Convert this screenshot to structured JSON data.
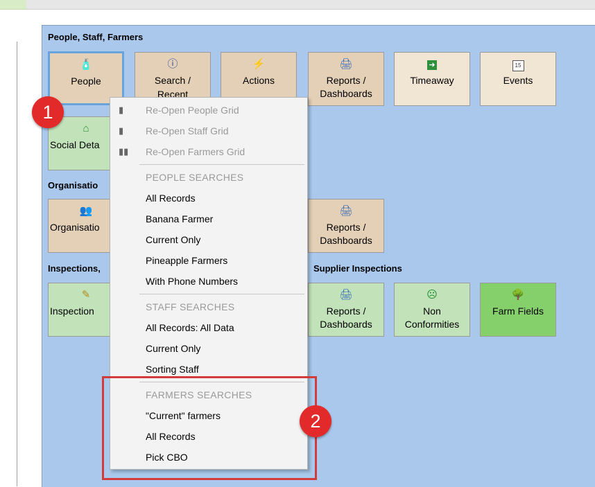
{
  "sections": {
    "people": "People, Staff, Farmers",
    "organisations": "Organisatio",
    "inspections_left": "Inspections,",
    "supplier_inspections": "Supplier Inspections"
  },
  "tiles": {
    "people": {
      "label": "People",
      "icon": "bottle-icon"
    },
    "search": {
      "label": "Search /",
      "label2": "Recent",
      "icon": "info-icon"
    },
    "actions": {
      "label": "Actions",
      "icon": "lightning-icon"
    },
    "reports1": {
      "label": "Reports /",
      "label2": "Dashboards",
      "icon": "printer-icon"
    },
    "timeaway": {
      "label": "Timeaway",
      "icon": "arrow-right-icon"
    },
    "events": {
      "label": "Events",
      "icon": "calendar-icon",
      "icon_text": "15"
    },
    "social": {
      "label": "Social Deta",
      "icon": "house-icon"
    },
    "organisations": {
      "label": "Organisatio",
      "icon": "group-icon"
    },
    "reports2": {
      "label": "Reports /",
      "label2": "Dashboards",
      "icon": "printer-icon"
    },
    "inspections": {
      "label": "Inspection",
      "icon": "pencil-icon"
    },
    "reports3": {
      "label": "Reports /",
      "label2": "Dashboards",
      "icon": "printer-icon"
    },
    "nonconformities": {
      "label": "Non",
      "label2": "Conformities",
      "icon": "sad-face-icon"
    },
    "farmfields": {
      "label": "Farm Fields",
      "icon": "tree-icon"
    }
  },
  "badges": {
    "one": "1",
    "two": "2"
  },
  "menu": {
    "reopen_people": "Re-Open People Grid",
    "reopen_staff": "Re-Open Staff Grid",
    "reopen_farmers": "Re-Open Farmers Grid",
    "people_header": "PEOPLE  SEARCHES",
    "people_items": [
      "All Records",
      "Banana Farmer",
      "Current Only",
      "Pineapple Farmers",
      "With Phone Numbers"
    ],
    "staff_header": "STAFF  SEARCHES",
    "staff_items": [
      "All Records: All Data",
      "Current Only",
      "Sorting Staff"
    ],
    "farmers_header": "FARMERS  SEARCHES",
    "farmers_items": [
      "\"Current\" farmers",
      "All Records",
      "Pick CBO"
    ]
  },
  "colors": {
    "panel": "#a9c8ec",
    "tile_beige": "#e3d0b6",
    "tile_green": "#c2e3ba",
    "tile_bright_green": "#86d06c",
    "badge_red": "#e32a2a",
    "highlight_red": "#d23b3b"
  }
}
